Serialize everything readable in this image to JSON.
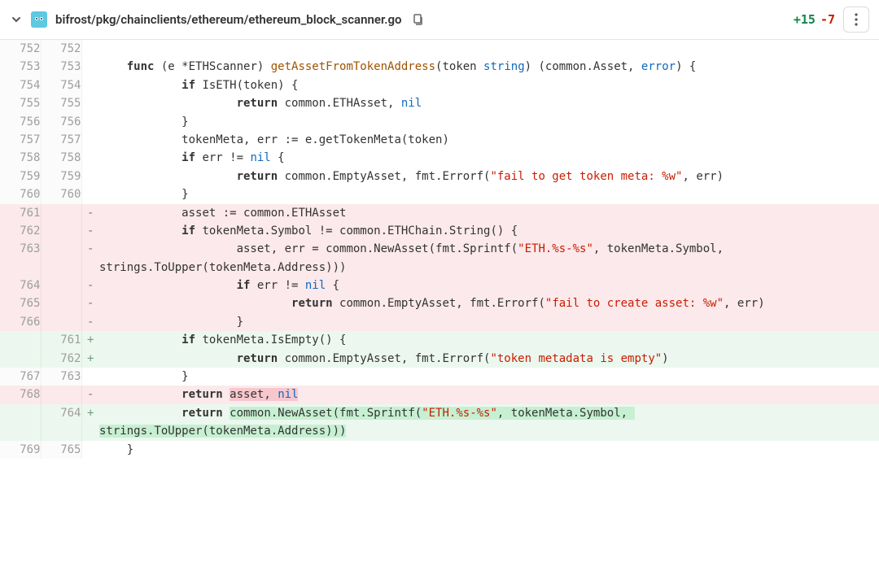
{
  "header": {
    "file_path": "bifrost/pkg/chainclients/ethereum/ethereum_block_scanner.go",
    "additions": "+15",
    "deletions": "-7"
  },
  "lines": [
    {
      "old": "752",
      "new": "752",
      "type": "ctx",
      "sign": "",
      "segs": [
        {
          "t": ""
        }
      ]
    },
    {
      "old": "753",
      "new": "753",
      "type": "ctx",
      "sign": "",
      "segs": [
        {
          "t": "    "
        },
        {
          "t": "func",
          "c": "kw"
        },
        {
          "t": " (e *ETHScanner) "
        },
        {
          "t": "getAssetFromTokenAddress",
          "c": "fn"
        },
        {
          "t": "(token "
        },
        {
          "t": "string",
          "c": "typ"
        },
        {
          "t": ") (common.Asset, "
        },
        {
          "t": "error",
          "c": "typ"
        },
        {
          "t": ") {"
        }
      ]
    },
    {
      "old": "754",
      "new": "754",
      "type": "ctx",
      "sign": "",
      "segs": [
        {
          "t": "            "
        },
        {
          "t": "if",
          "c": "kw"
        },
        {
          "t": " IsETH(token) {"
        }
      ]
    },
    {
      "old": "755",
      "new": "755",
      "type": "ctx",
      "sign": "",
      "segs": [
        {
          "t": "                    "
        },
        {
          "t": "return",
          "c": "kw"
        },
        {
          "t": " common.ETHAsset, "
        },
        {
          "t": "nil",
          "c": "lit"
        }
      ]
    },
    {
      "old": "756",
      "new": "756",
      "type": "ctx",
      "sign": "",
      "segs": [
        {
          "t": "            }"
        }
      ]
    },
    {
      "old": "757",
      "new": "757",
      "type": "ctx",
      "sign": "",
      "segs": [
        {
          "t": "            tokenMeta, err := e.getTokenMeta(token)"
        }
      ]
    },
    {
      "old": "758",
      "new": "758",
      "type": "ctx",
      "sign": "",
      "segs": [
        {
          "t": "            "
        },
        {
          "t": "if",
          "c": "kw"
        },
        {
          "t": " err != "
        },
        {
          "t": "nil",
          "c": "lit"
        },
        {
          "t": " {"
        }
      ]
    },
    {
      "old": "759",
      "new": "759",
      "type": "ctx",
      "sign": "",
      "segs": [
        {
          "t": "                    "
        },
        {
          "t": "return",
          "c": "kw"
        },
        {
          "t": " common.EmptyAsset, fmt.Errorf("
        },
        {
          "t": "\"fail to get token meta: %w\"",
          "c": "str"
        },
        {
          "t": ", err)"
        }
      ]
    },
    {
      "old": "760",
      "new": "760",
      "type": "ctx",
      "sign": "",
      "segs": [
        {
          "t": "            }"
        }
      ]
    },
    {
      "old": "761",
      "new": "",
      "type": "del",
      "sign": "-",
      "segs": [
        {
          "t": "            asset := common.ETHAsset"
        }
      ]
    },
    {
      "old": "762",
      "new": "",
      "type": "del",
      "sign": "-",
      "segs": [
        {
          "t": "            "
        },
        {
          "t": "if",
          "c": "kw"
        },
        {
          "t": " tokenMeta.Symbol != common.ETHChain.String() {"
        }
      ]
    },
    {
      "old": "763",
      "new": "",
      "type": "del",
      "sign": "-",
      "segs": [
        {
          "t": "                    asset, err = common.NewAsset(fmt.Sprintf("
        },
        {
          "t": "\"ETH.%s-%s\"",
          "c": "str"
        },
        {
          "t": ", tokenMeta.Symbol, strings.ToUpper(tokenMeta.Address)))"
        }
      ]
    },
    {
      "old": "764",
      "new": "",
      "type": "del",
      "sign": "-",
      "segs": [
        {
          "t": "                    "
        },
        {
          "t": "if",
          "c": "kw"
        },
        {
          "t": " err != "
        },
        {
          "t": "nil",
          "c": "lit"
        },
        {
          "t": " {"
        }
      ]
    },
    {
      "old": "765",
      "new": "",
      "type": "del",
      "sign": "-",
      "segs": [
        {
          "t": "                            "
        },
        {
          "t": "return",
          "c": "kw"
        },
        {
          "t": " common.EmptyAsset, fmt.Errorf("
        },
        {
          "t": "\"fail to create asset: %w\"",
          "c": "str"
        },
        {
          "t": ", err)"
        }
      ]
    },
    {
      "old": "766",
      "new": "",
      "type": "del",
      "sign": "-",
      "segs": [
        {
          "t": "                    }"
        }
      ]
    },
    {
      "old": "",
      "new": "761",
      "type": "add",
      "sign": "+",
      "segs": [
        {
          "t": "            "
        },
        {
          "t": "if",
          "c": "kw"
        },
        {
          "t": " tokenMeta.IsEmpty() {"
        }
      ]
    },
    {
      "old": "",
      "new": "762",
      "type": "add",
      "sign": "+",
      "segs": [
        {
          "t": "                    "
        },
        {
          "t": "return",
          "c": "kw"
        },
        {
          "t": " common.EmptyAsset, fmt.Errorf("
        },
        {
          "t": "\"token metadata is empty\"",
          "c": "str"
        },
        {
          "t": ")"
        }
      ]
    },
    {
      "old": "767",
      "new": "763",
      "type": "ctx",
      "sign": "",
      "segs": [
        {
          "t": "            }"
        }
      ]
    },
    {
      "old": "768",
      "new": "",
      "type": "del",
      "sign": "-",
      "segs": [
        {
          "t": "            "
        },
        {
          "t": "return",
          "c": "kw"
        },
        {
          "t": " "
        },
        {
          "t": "asset, ",
          "c": "inline-del"
        },
        {
          "t": "nil",
          "c": "lit inline-del"
        }
      ]
    },
    {
      "old": "",
      "new": "764",
      "type": "add",
      "sign": "+",
      "segs": [
        {
          "t": "            "
        },
        {
          "t": "return",
          "c": "kw"
        },
        {
          "t": " "
        },
        {
          "t": "common.NewAsset(fmt.Sprintf(",
          "c": "inline-add"
        },
        {
          "t": "\"ETH.%s-%s\"",
          "c": "str inline-add"
        },
        {
          "t": ", tokenMeta.Symbol, strings.ToUpper(tokenMeta.Address)))",
          "c": "inline-add"
        }
      ]
    },
    {
      "old": "769",
      "new": "765",
      "type": "ctx",
      "sign": "",
      "segs": [
        {
          "t": "    }"
        }
      ]
    }
  ]
}
